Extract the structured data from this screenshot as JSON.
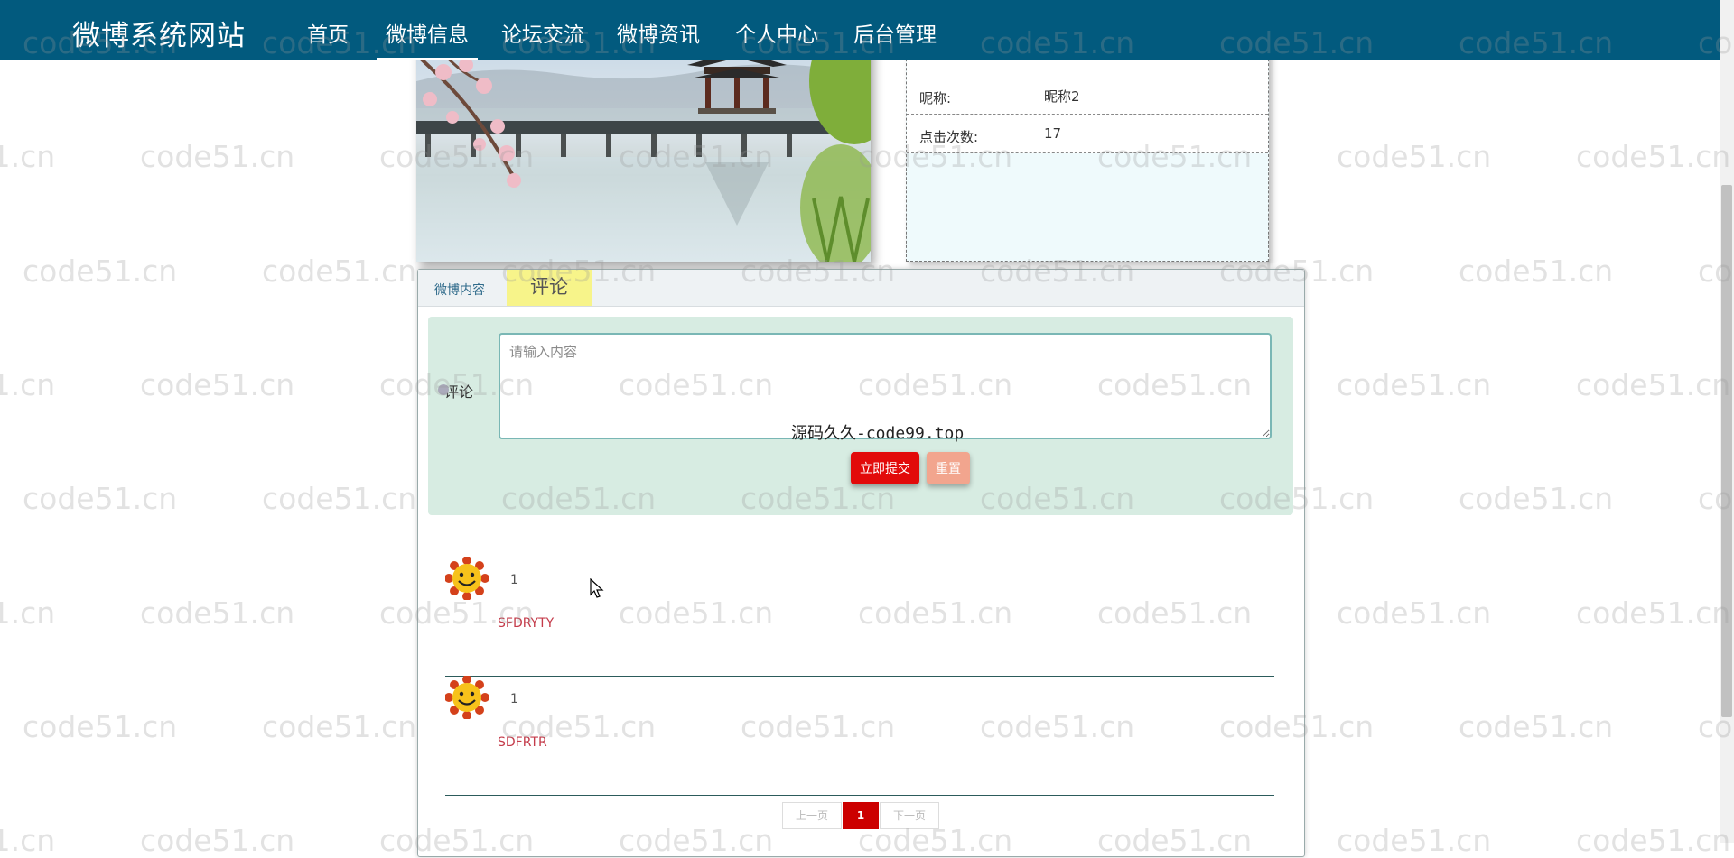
{
  "nav": {
    "brand": "微博系统网站",
    "items": [
      {
        "label": "首页",
        "active": false
      },
      {
        "label": "微博信息",
        "active": true
      },
      {
        "label": "论坛交流",
        "active": false
      },
      {
        "label": "微博资讯",
        "active": false
      },
      {
        "label": "个人中心",
        "active": false
      },
      {
        "label": "后台管理",
        "active": false
      }
    ],
    "bg_color": "#025a7e"
  },
  "watermark": "code51.cn",
  "info": {
    "nickname_label": "昵称:",
    "nickname_value": "昵称2",
    "clicks_label": "点击次数:",
    "clicks_value": "17"
  },
  "tabs": {
    "content": "微博内容",
    "comments": "评论"
  },
  "form": {
    "label": "评论",
    "placeholder": "请输入内容",
    "overlay_text": "源码久久-code99.top",
    "submit": "立即提交",
    "reset": "重置"
  },
  "comments": [
    {
      "text": "1",
      "user": "SFDRYTY"
    },
    {
      "text": "1",
      "user": "SDFRTR"
    }
  ],
  "pagination": {
    "prev": "上一页",
    "current": "1",
    "next": "下一页"
  }
}
